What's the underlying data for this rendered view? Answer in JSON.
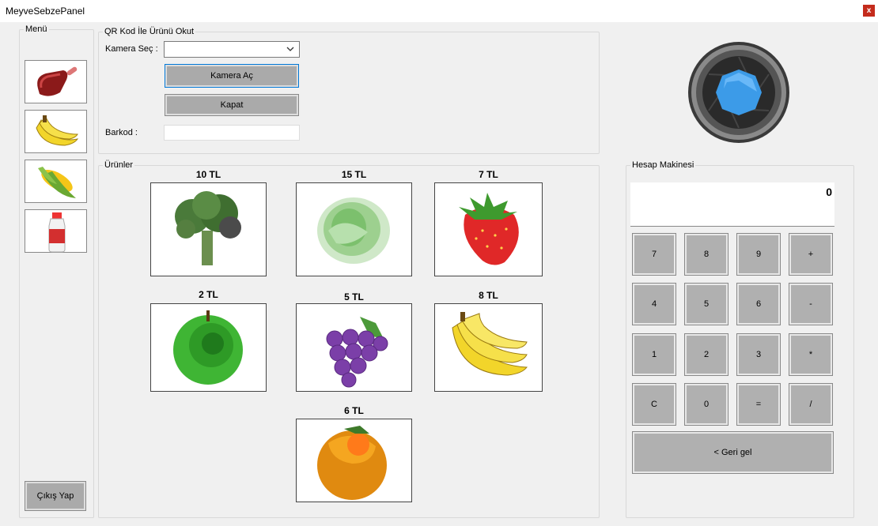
{
  "window": {
    "title": "MeyveSebzePanel",
    "close_label": "x"
  },
  "menu": {
    "legend": "Menü",
    "categories": [
      {
        "name": "meat",
        "icon": "meat-icon"
      },
      {
        "name": "banana",
        "icon": "banana-icon"
      },
      {
        "name": "corn",
        "icon": "corn-icon"
      },
      {
        "name": "milk",
        "icon": "milk-bottle-icon"
      }
    ],
    "logout_label": "Çıkış Yap"
  },
  "qr": {
    "legend": "QR Kod İle Ürünü Okut",
    "camera_label": "Kamera Seç :",
    "camera_value": "",
    "open_label": "Kamera Aç",
    "close_label": "Kapat",
    "barcode_label": "Barkod :",
    "barcode_value": ""
  },
  "camera_icon": "camera-lens-icon",
  "products": {
    "legend": "Ürünler",
    "items": [
      {
        "price": "10 TL",
        "icon": "broccoli-icon"
      },
      {
        "price": "15 TL",
        "icon": "lettuce-icon"
      },
      {
        "price": "7 TL",
        "icon": "strawberry-icon"
      },
      {
        "price": "2 TL",
        "icon": "green-apple-icon"
      },
      {
        "price": "5 TL",
        "icon": "grapes-icon"
      },
      {
        "price": "8 TL",
        "icon": "banana-icon"
      },
      {
        "price": "6 TL",
        "icon": "orange-icon"
      }
    ]
  },
  "calculator": {
    "legend": "Hesap Makinesi",
    "display": "0",
    "keys": [
      "7",
      "8",
      "9",
      "+",
      "4",
      "5",
      "6",
      "-",
      "1",
      "2",
      "3",
      "*",
      "C",
      "0",
      "=",
      "/"
    ],
    "back_label": "< Geri gel"
  }
}
